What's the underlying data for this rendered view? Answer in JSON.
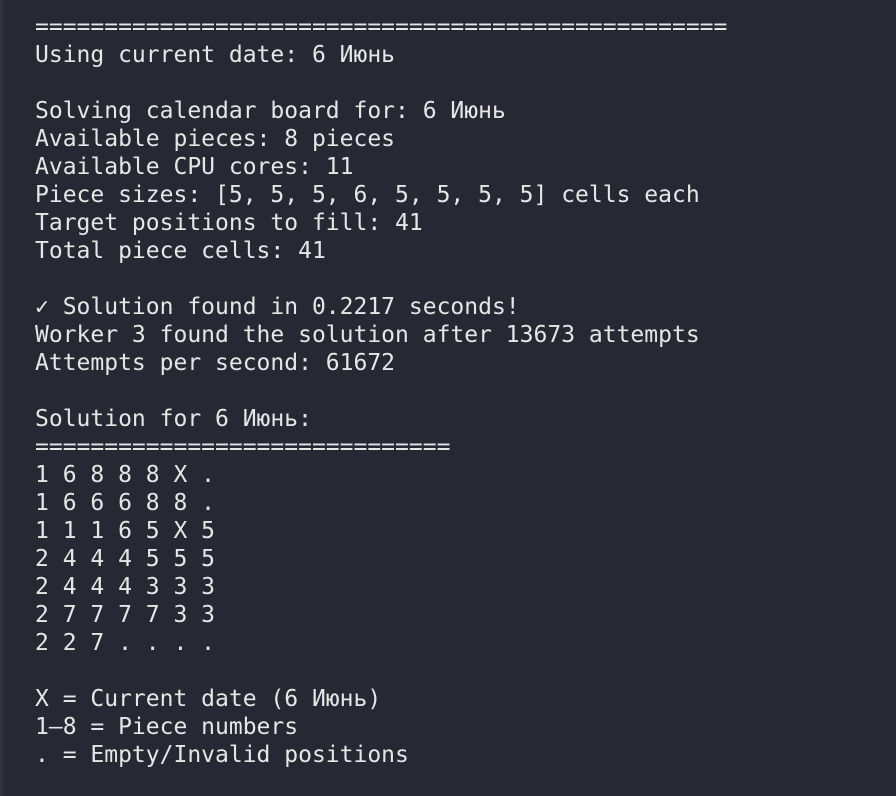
{
  "colors": {
    "background": "#262833",
    "text": "#e6e6e6"
  },
  "lines": [
    "==================================================",
    "Using current date: 6 Июнь",
    "",
    "Solving calendar board for: 6 Июнь",
    "Available pieces: 8 pieces",
    "Available CPU cores: 11",
    "Piece sizes: [5, 5, 5, 6, 5, 5, 5, 5] cells each",
    "Target positions to fill: 41",
    "Total piece cells: 41",
    "",
    "✓ Solution found in 0.2217 seconds!",
    "Worker 3 found the solution after 13673 attempts",
    "Attempts per second: 61672",
    "",
    "Solution for 6 Июнь:",
    "==============================",
    "1 6 8 8 8 X .",
    "1 6 6 6 8 8 .",
    "1 1 1 6 5 X 5",
    "2 4 4 4 5 5 5",
    "2 4 4 4 3 3 3",
    "2 7 7 7 7 3 3",
    "2 2 7 . . . .",
    "",
    "X = Current date (6 Июнь)",
    "1–8 = Piece numbers",
    ". = Empty/Invalid positions"
  ]
}
